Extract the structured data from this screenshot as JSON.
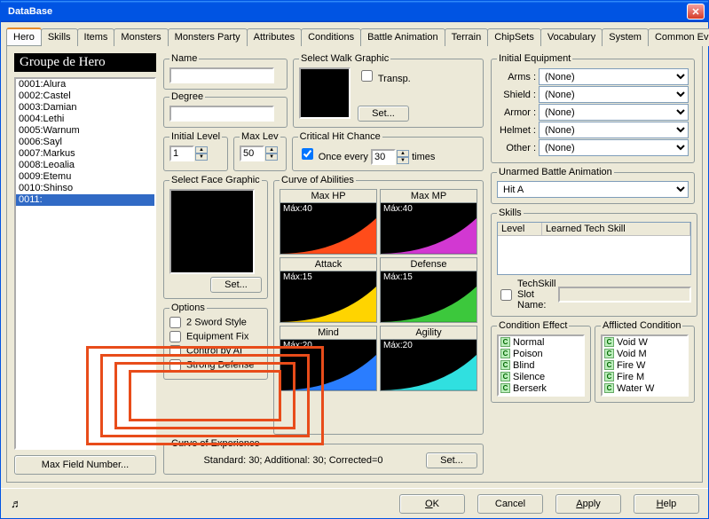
{
  "window": {
    "title": "DataBase"
  },
  "tabs": [
    "Hero",
    "Skills",
    "Items",
    "Monsters",
    "Monsters Party",
    "Attributes",
    "Conditions",
    "Battle Animation",
    "Terrain",
    "ChipSets",
    "Vocabulary",
    "System",
    "Common Events"
  ],
  "active_tab": 0,
  "left": {
    "header": "Groupe de Hero",
    "items": [
      "0001:Alura",
      "0002:Castel",
      "0003:Damian",
      "0004:Lethi",
      "0005:Warnum",
      "0006:Sayl",
      "0007:Markus",
      "0008:Leoalia",
      "0009:Etemu",
      "0010:Shinso",
      "0011:"
    ],
    "selected": 10,
    "max_field_btn": "Max Field Number..."
  },
  "hero": {
    "name_label": "Name",
    "name": "",
    "degree_label": "Degree",
    "degree": "",
    "walk_label": "Select Walk Graphic",
    "transp_label": "Transp.",
    "transp": false,
    "set_btn": "Set...",
    "ilvl_label": "Initial Level",
    "ilvl": "1",
    "mlvl_label": "Max Lev",
    "mlvl": "50",
    "crit_label": "Critical Hit Chance",
    "crit_once": "Once every",
    "crit_val": "30",
    "crit_times": "times",
    "face_label": "Select Face Graphic",
    "curve_label": "Curve of Abilities",
    "curves": [
      {
        "name": "Max HP",
        "max": "Máx:40",
        "color": "#ff4c1a"
      },
      {
        "name": "Max MP",
        "max": "Máx:40",
        "color": "#d238d2"
      },
      {
        "name": "Attack",
        "max": "Máx:15",
        "color": "#ffd400"
      },
      {
        "name": "Defense",
        "max": "Máx:15",
        "color": "#3cc83c"
      },
      {
        "name": "Mind",
        "max": "Máx:20",
        "color": "#2a7dff"
      },
      {
        "name": "Agility",
        "max": "Máx:20",
        "color": "#30e0e0"
      }
    ],
    "options_label": "Options",
    "options": [
      {
        "label": "2 Sword Style",
        "checked": false
      },
      {
        "label": "Equipment Fix",
        "checked": false
      },
      {
        "label": "Control by AI",
        "checked": false
      },
      {
        "label": "Strong Defense",
        "checked": false
      }
    ],
    "coe_label": "Curve of Experience",
    "coe_text": "Standard: 30; Additional: 30; Corrected=0"
  },
  "right": {
    "eq_label": "Initial Equipment",
    "eq": [
      {
        "k": "Arms :",
        "v": "(None)"
      },
      {
        "k": "Shield :",
        "v": "(None)"
      },
      {
        "k": "Armor :",
        "v": "(None)"
      },
      {
        "k": "Helmet :",
        "v": "(None)"
      },
      {
        "k": "Other :",
        "v": "(None)"
      }
    ],
    "uba_label": "Unarmed Battle Animation",
    "uba": "Hit A",
    "skills_label": "Skills",
    "skills_cols": [
      "Level",
      "Learned Tech Skill"
    ],
    "techskill_chk": "TechSkill Slot Name:",
    "cond_effect_label": "Condition Effect",
    "cond_effect": [
      "Normal",
      "Poison",
      "Blind",
      "Silence",
      "Berserk"
    ],
    "affl_label": "Afflicted Condition",
    "affl": [
      "Void W",
      "Void M",
      "Fire W",
      "Fire M",
      "Water W"
    ]
  },
  "buttons": {
    "ok": "OK",
    "cancel": "Cancel",
    "apply": "Apply",
    "help": "Help"
  }
}
